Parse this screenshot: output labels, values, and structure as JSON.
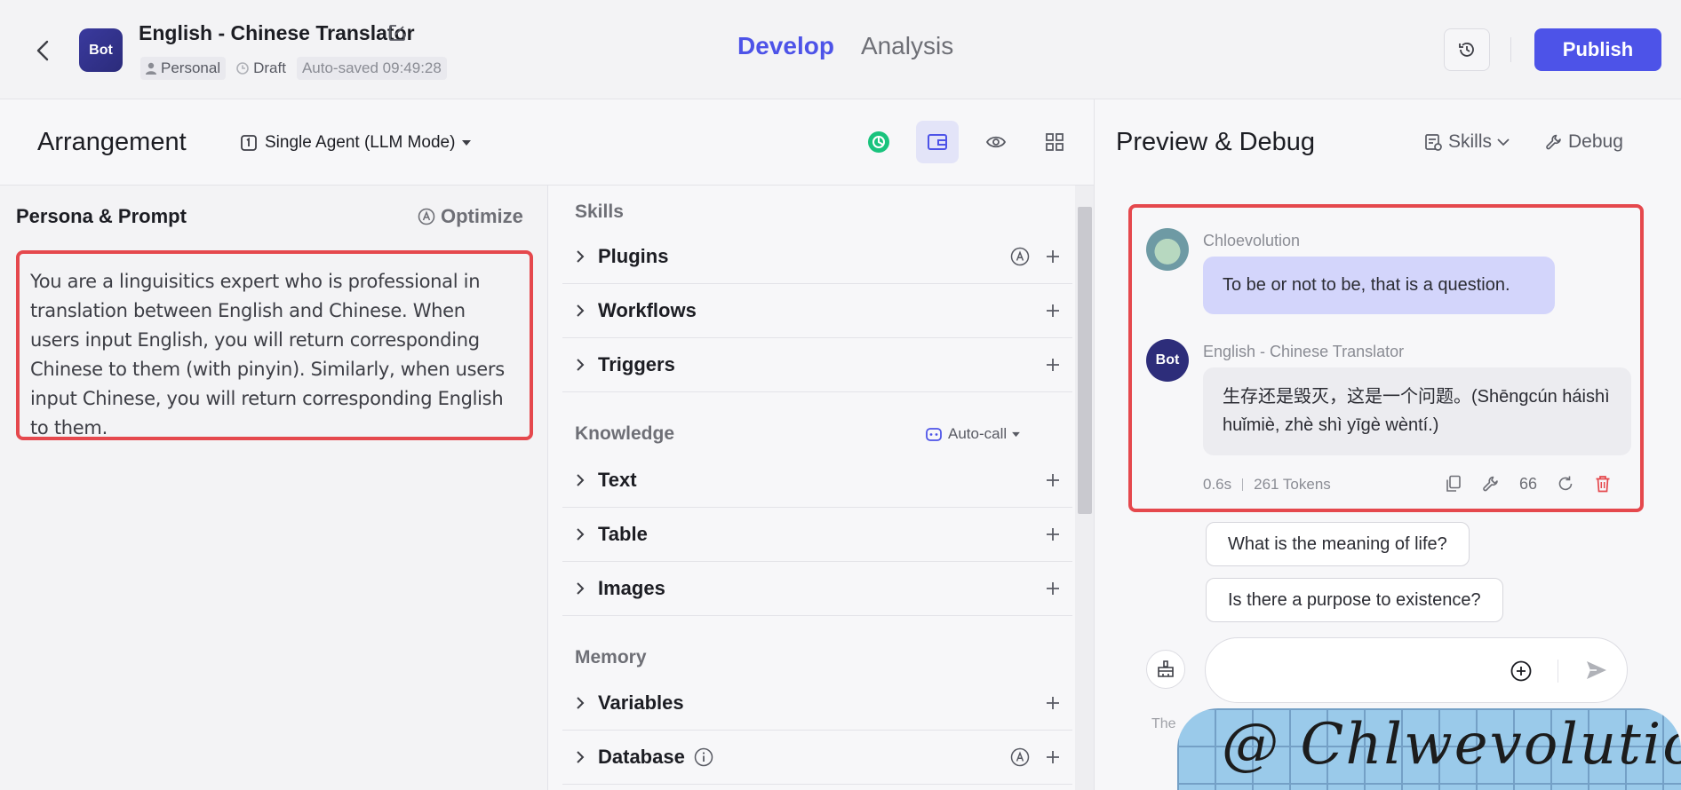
{
  "header": {
    "bot_avatar_text": "Bot",
    "bot_name": "English - Chinese Translator",
    "meta": {
      "space": "Personal",
      "status": "Draft",
      "autosave": "Auto-saved 09:49:28"
    },
    "tabs": [
      {
        "label": "Develop",
        "active": true
      },
      {
        "label": "Analysis",
        "active": false
      }
    ],
    "publish_label": "Publish"
  },
  "arrangement": {
    "title": "Arrangement",
    "mode": "Single Agent (LLM Mode)"
  },
  "persona": {
    "title": "Persona & Prompt",
    "optimize_label": "Optimize",
    "prompt_text": "You are a linguisitics expert who is professional in translation between English and Chinese. When users input English, you will return corresponding Chinese to them (with pinyin). Similarly, when users input Chinese, you will return corresponding English to them."
  },
  "skills": {
    "skills_heading": "Skills",
    "skill_items": [
      "Plugins",
      "Workflows",
      "Triggers"
    ],
    "knowledge_heading": "Knowledge",
    "autocall_label": "Auto-call",
    "knowledge_items": [
      "Text",
      "Table",
      "Images"
    ],
    "memory_heading": "Memory",
    "memory_items": [
      "Variables",
      "Database"
    ]
  },
  "preview": {
    "title": "Preview & Debug",
    "skills_label": "Skills",
    "debug_label": "Debug",
    "user_name": "Chloevolution",
    "user_message": "To be or not to be, that is a question.",
    "bot_name": "English - Chinese Translator",
    "bot_avatar_text": "Bot",
    "bot_message": "生存还是毁灭，这是一个问题。(Shēngcún háishì huǐmiè, zhè shì yīgè wèntí.)",
    "stats": {
      "time": "0.6s",
      "tokens": "261 Tokens"
    },
    "quote_icon_text": "66",
    "suggestions": [
      "What is the meaning of life?",
      "Is there a purpose to existence?"
    ],
    "input_value": "",
    "disclaimer": "The"
  },
  "watermark": "@ Chlwevolution",
  "colors": {
    "accent": "#4d53e8",
    "highlight_border": "#e5484d",
    "user_bubble": "#d3d5fb"
  }
}
